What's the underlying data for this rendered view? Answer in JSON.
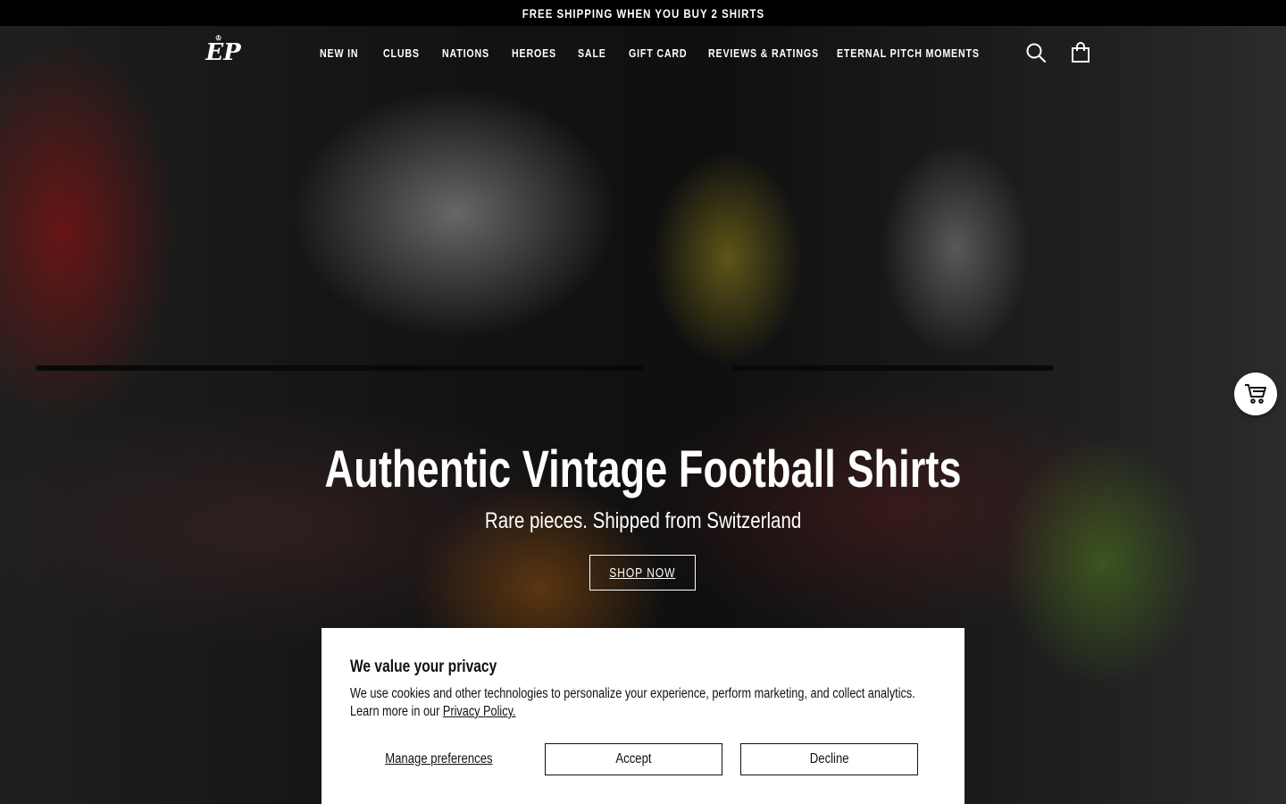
{
  "announcement": "FREE SHIPPING WHEN YOU BUY 2 SHIRTS",
  "header": {
    "logo_text": "EP",
    "nav": [
      {
        "label": "NEW IN"
      },
      {
        "label": "CLUBS"
      },
      {
        "label": "NATIONS"
      },
      {
        "label": "HEROES"
      },
      {
        "label": "SALE"
      },
      {
        "label": "GIFT CARD"
      },
      {
        "label": "REVIEWS & RATINGS"
      },
      {
        "label": "ETERNAL PITCH MOMENTS"
      }
    ],
    "icons": {
      "search": "search-icon",
      "cart": "shopping-bag-icon"
    }
  },
  "hero": {
    "title": "Authentic Vintage Football Shirts",
    "subtitle": "Rare pieces. Shipped from Switzerland",
    "cta": "SHOP NOW",
    "image_description": ""
  },
  "floating_cart": {
    "icon": "cart-icon"
  },
  "consent": {
    "title": "We value your privacy",
    "text": "We use cookies and other technologies to personalize your experience, perform marketing, and collect analytics. Learn more in our ",
    "link": "Privacy Policy.",
    "manage": "Manage preferences",
    "accept": "Accept",
    "decline": "Decline"
  },
  "colors": {
    "announcement_bg": "#000000",
    "text_light": "#ffffff",
    "panel_bg": "#ffffff"
  }
}
